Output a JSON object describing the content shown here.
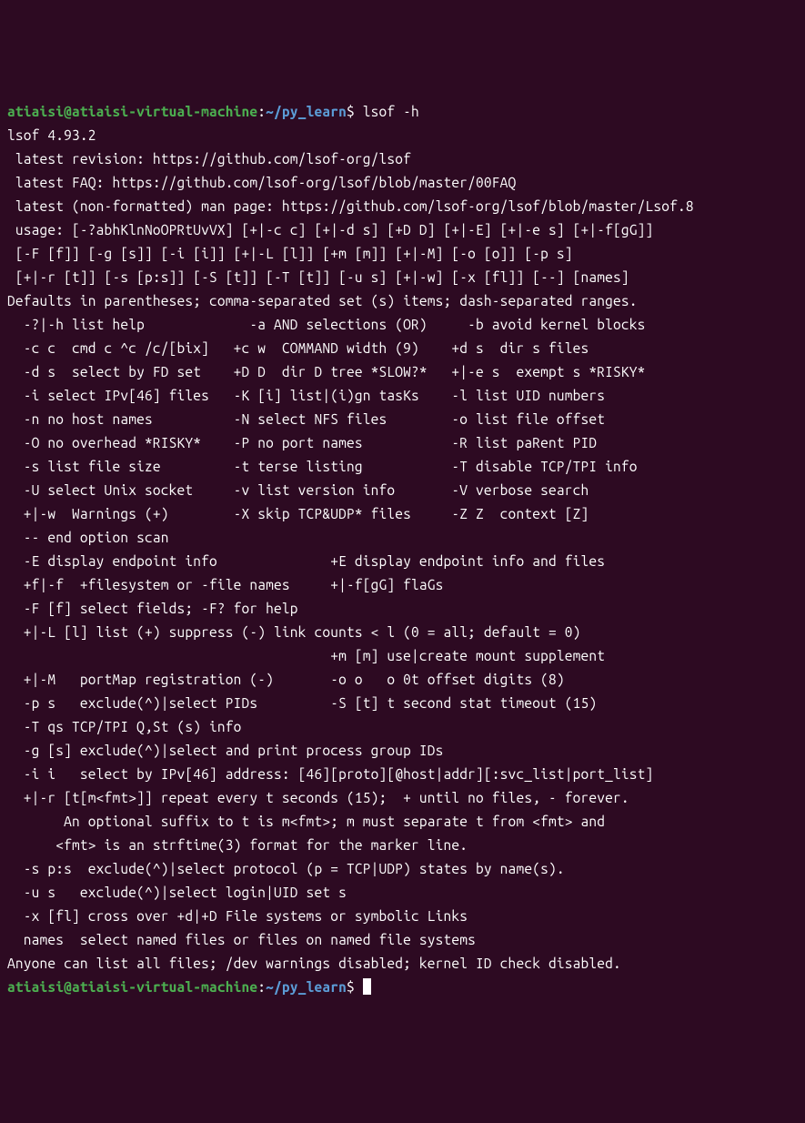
{
  "prompt1": {
    "user": "atiaisi@atiaisi-virtual-machine",
    "colon": ":",
    "path": "~/py_learn",
    "dollar": "$",
    "command": " lsof -h"
  },
  "output_lines": [
    "lsof 4.93.2",
    " latest revision: https://github.com/lsof-org/lsof",
    " latest FAQ: https://github.com/lsof-org/lsof/blob/master/00FAQ",
    " latest (non-formatted) man page: https://github.com/lsof-org/lsof/blob/master/Lsof.8",
    " usage: [-?abhKlnNoOPRtUvVX] [+|-c c] [+|-d s] [+D D] [+|-E] [+|-e s] [+|-f[gG]]",
    " [-F [f]] [-g [s]] [-i [i]] [+|-L [l]] [+m [m]] [+|-M] [-o [o]] [-p s]",
    " [+|-r [t]] [-s [p:s]] [-S [t]] [-T [t]] [-u s] [+|-w] [-x [fl]] [--] [names]",
    "Defaults in parentheses; comma-separated set (s) items; dash-separated ranges.",
    "  -?|-h list help             -a AND selections (OR)     -b avoid kernel blocks",
    "  -c c  cmd c ^c /c/[bix]   +c w  COMMAND width (9)    +d s  dir s files",
    "  -d s  select by FD set    +D D  dir D tree *SLOW?*   +|-e s  exempt s *RISKY*",
    "  -i select IPv[46] files   -K [i] list|(i)gn tasKs    -l list UID numbers",
    "  -n no host names          -N select NFS files        -o list file offset",
    "  -O no overhead *RISKY*    -P no port names           -R list paRent PID",
    "  -s list file size         -t terse listing           -T disable TCP/TPI info",
    "  -U select Unix socket     -v list version info       -V verbose search",
    "  +|-w  Warnings (+)        -X skip TCP&UDP* files     -Z Z  context [Z]",
    "  -- end option scan      ",
    "  -E display endpoint info              +E display endpoint info and files  ",
    "  +f|-f  +filesystem or -file names     +|-f[gG] flaGs ",
    "  -F [f] select fields; -F? for help  ",
    "  +|-L [l] list (+) suppress (-) link counts < l (0 = all; default = 0)",
    "                                        +m [m] use|create mount supplement",
    "  +|-M   portMap registration (-)       -o o   o 0t offset digits (8)",
    "  -p s   exclude(^)|select PIDs         -S [t] t second stat timeout (15)",
    "  -T qs TCP/TPI Q,St (s) info",
    "  -g [s] exclude(^)|select and print process group IDs",
    "  -i i   select by IPv[46] address: [46][proto][@host|addr][:svc_list|port_list]",
    "  +|-r [t[m<fmt>]] repeat every t seconds (15);  + until no files, - forever.",
    "       An optional suffix to t is m<fmt>; m must separate t from <fmt> and",
    "      <fmt> is an strftime(3) format for the marker line.",
    "  -s p:s  exclude(^)|select protocol (p = TCP|UDP) states by name(s).",
    "  -u s   exclude(^)|select login|UID set s",
    "  -x [fl] cross over +d|+D File systems or symbolic Links",
    "  names  select named files or files on named file systems",
    "Anyone can list all files; /dev warnings disabled; kernel ID check disabled."
  ],
  "prompt2": {
    "user": "atiaisi@atiaisi-virtual-machine",
    "colon": ":",
    "path": "~/py_learn",
    "dollar": "$",
    "command": " "
  }
}
